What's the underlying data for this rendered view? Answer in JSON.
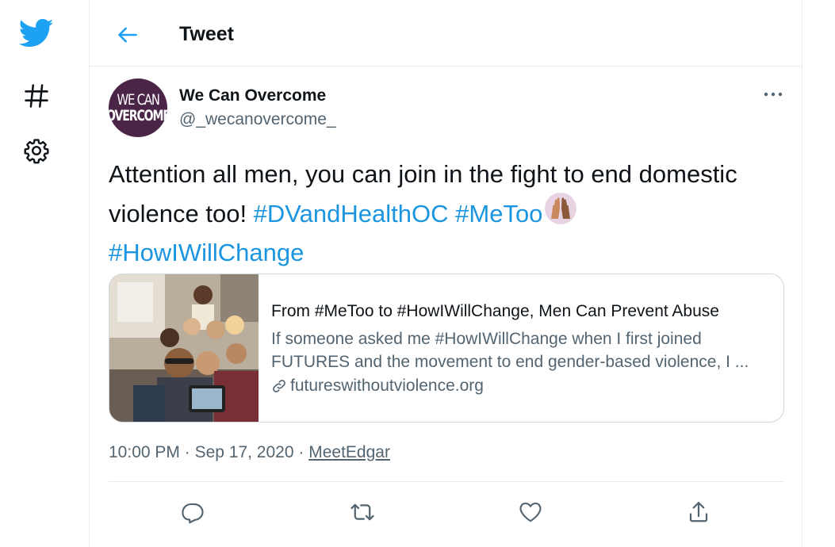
{
  "header": {
    "title": "Tweet"
  },
  "nav": {
    "logo_icon": "twitter-bird-icon",
    "explore_icon": "hashtag-icon",
    "settings_icon": "gear-icon"
  },
  "tweet": {
    "author": {
      "display_name": "We Can Overcome",
      "handle": "@_wecanovercome_",
      "avatar_line1": "WE CAN",
      "avatar_line2": "OVERCOME"
    },
    "text_plain": "Attention all men, you can join in the fight to end domestic violence too! ",
    "hashtags": [
      "#DVandHealthOC",
      "#MeToo",
      "#HowIWillChange"
    ],
    "emoji": "raised-hands-emoji",
    "card": {
      "title": "From #MeToo to #HowIWillChange, Men Can Prevent Abuse",
      "description": "If someone asked me #HowIWillChange when I first joined FUTURES and the movement to end gender-based violence, I ...",
      "domain": "futureswithoutviolence.org"
    },
    "time": "10:00 PM",
    "separator": "·",
    "date": "Sep 17, 2020",
    "source": "MeetEdgar"
  },
  "actions": {
    "reply_icon": "reply-icon",
    "retweet_icon": "retweet-icon",
    "like_icon": "heart-icon",
    "share_icon": "share-icon"
  },
  "colors": {
    "brand": "#1da1f2",
    "link": "#1b95e0",
    "secondary_text": "#536471",
    "border": "#e6ecf0",
    "avatar_bg": "#4a2547"
  }
}
